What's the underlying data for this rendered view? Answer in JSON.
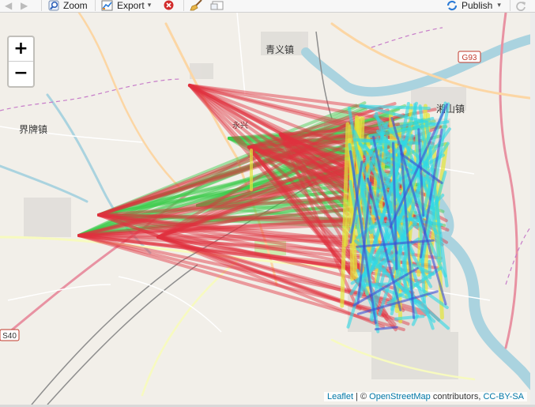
{
  "toolbar": {
    "back_icon": "back-arrow-icon",
    "forward_icon": "forward-arrow-icon",
    "zoom_label": "Zoom",
    "export_label": "Export",
    "export_caret": "▾",
    "publish_label": "Publish",
    "publish_caret": "▾"
  },
  "map": {
    "zoom_in": "+",
    "zoom_out": "−",
    "place_labels": [
      "青义镇",
      "界牌镇",
      "永兴",
      "湘山镇"
    ],
    "road_shields": [
      "G93",
      "S40"
    ],
    "attribution": {
      "leaflet": "Leaflet",
      "sep": " | © ",
      "osm": "OpenStreetMap",
      "contributors": " contributors, ",
      "license": "CC-BY-SA"
    }
  },
  "colors": {
    "red": "#e0303f",
    "green": "#3ccc4c",
    "yellow": "#e2e63a",
    "cyan": "#2ed8e6",
    "blue": "#3a4fd6",
    "river": "#aad3df",
    "shield_bg": "#ffffff",
    "shield_border": "#c0392b"
  }
}
